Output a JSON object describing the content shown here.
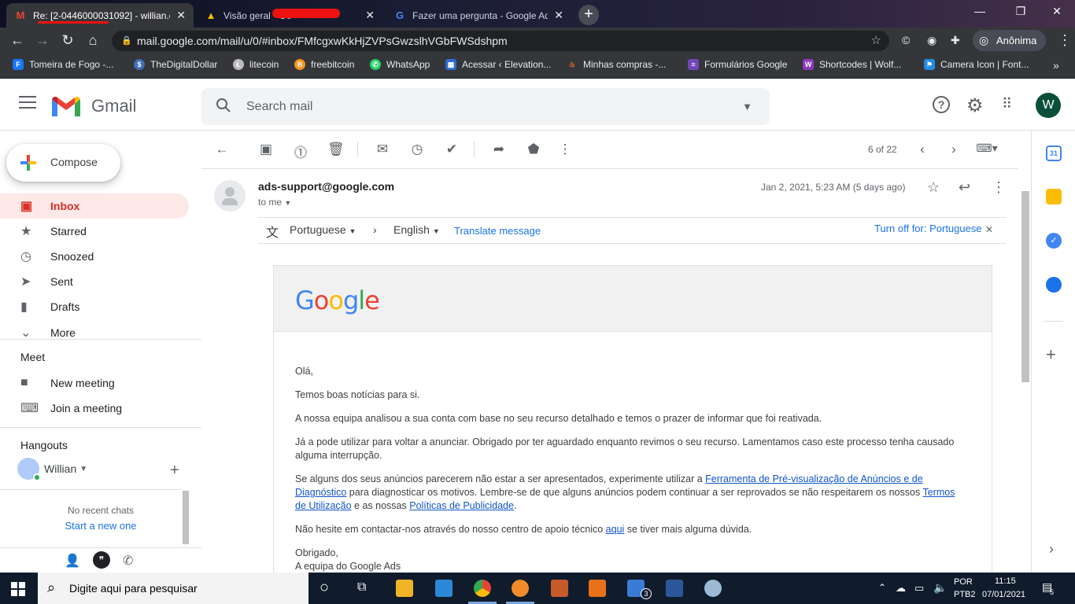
{
  "browser": {
    "tabs": [
      {
        "title": "Re: [2-0446000031092] - willian.e",
        "icon": "gmail-icon",
        "active": true
      },
      {
        "title": "Visão geral - Go",
        "icon": "google-ads-icon",
        "active": false
      },
      {
        "title": "Fazer uma pergunta - Google Ad",
        "icon": "google-icon",
        "active": false
      }
    ],
    "url": "mail.google.com/mail/u/0/#inbox/FMfcgxwKkHjZVPsGwzslhVGbFWSdshpm",
    "incognito_label": "Anônima",
    "bookmarks": [
      "Tomeira de Fogo -...",
      "TheDigitalDollar",
      "litecoin",
      "freebitcoin",
      "WhatsApp",
      "Acessar ‹ Elevation...",
      "Minhas compras -...",
      "Formulários Google",
      "Shortcodes | Wolf...",
      "Camera Icon | Font..."
    ]
  },
  "gmail": {
    "app_name": "Gmail",
    "search_placeholder": "Search mail",
    "avatar_letter": "W",
    "compose_label": "Compose",
    "nav": [
      {
        "label": "Inbox",
        "icon": "inbox-icon",
        "active": true
      },
      {
        "label": "Starred",
        "icon": "star-icon",
        "active": false
      },
      {
        "label": "Snoozed",
        "icon": "clock-icon",
        "active": false
      },
      {
        "label": "Sent",
        "icon": "send-icon",
        "active": false
      },
      {
        "label": "Drafts",
        "icon": "draft-icon",
        "active": false
      },
      {
        "label": "More",
        "icon": "chevron-down-icon",
        "active": false
      }
    ],
    "meet": {
      "heading": "Meet",
      "items": [
        "New meeting",
        "Join a meeting"
      ]
    },
    "hangouts": {
      "heading": "Hangouts",
      "user": "Willian",
      "empty_text": "No recent chats",
      "start_link": "Start a new one"
    },
    "pager": "6 of 22"
  },
  "message": {
    "sender": "ads-support@google.com",
    "recipient": "to me",
    "date": "Jan 2, 2021, 5:23 AM (5 days ago)",
    "translate": {
      "from": "Portuguese",
      "to": "English",
      "action": "Translate message",
      "turn_off": "Turn off for: Portuguese"
    },
    "logo_text": "Google",
    "greeting": "Olá,",
    "p1": "Temos boas notícias para si.",
    "p2": "A nossa equipa analisou a sua conta com base no seu recurso detalhado e temos o prazer de informar que foi reativada.",
    "p3": "Já a pode utilizar para voltar a anunciar. Obrigado por ter aguardado enquanto revimos o seu recurso. Lamentamos caso este processo tenha causado alguma interrupção.",
    "p4_a": "Se alguns dos seus anúncios parecerem não estar a ser apresentados, experimente utilizar a ",
    "p4_link1": "Ferramenta de Pré-visualização de Anúncios e de Diagnóstico",
    "p4_b": " para diagnosticar os motivos. Lembre-se de que alguns anúncios podem continuar a ser reprovados se não respeitarem os nossos ",
    "p4_link2": "Termos de Utilização",
    "p4_c": " e as nossas ",
    "p4_link3": "Políticas de Publicidade",
    "p4_d": ".",
    "p5_a": "Não hesite em contactar-nos através do nosso centro de apoio técnico ",
    "p5_link": "aqui",
    "p5_b": " se tiver mais alguma dúvida.",
    "signoff": "Obrigado,",
    "signature": "A equipa do Google Ads"
  },
  "taskbar": {
    "search_placeholder": "Digite aqui para pesquisar",
    "lang_top": "POR",
    "lang_bottom": "PTB2",
    "time": "11:15",
    "date": "07/01/2021",
    "mail_badge": "3",
    "notif_count": "5"
  }
}
